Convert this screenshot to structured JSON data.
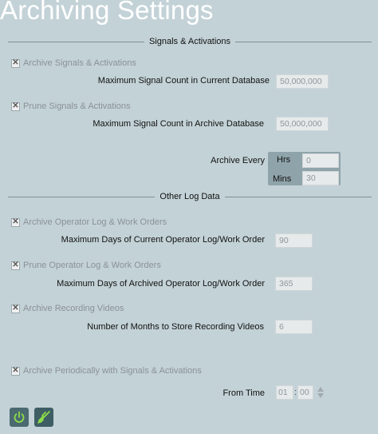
{
  "title": "Archiving Settings",
  "sections": {
    "signals": "Signals & Activations",
    "other": "Other Log Data"
  },
  "archive_signals": {
    "checkbox_label": "Archive Signals & Activations",
    "checked": true,
    "max_count_label": "Maximum Signal Count in Current Database",
    "max_count_value": "50,000,000"
  },
  "prune_signals": {
    "checkbox_label": "Prune Signals & Activations",
    "checked": true,
    "max_count_label": "Maximum Signal Count in Archive Database",
    "max_count_value": "50,000,000"
  },
  "archive_every": {
    "label": "Archive Every",
    "hrs_label": "Hrs",
    "hrs_value": "0",
    "mins_label": "Mins",
    "mins_value": "30"
  },
  "archive_operator_log": {
    "checkbox_label": "Archive Operator Log & Work Orders",
    "checked": true,
    "days_label": "Maximum Days of Current Operator Log/Work Order",
    "days_value": "90"
  },
  "prune_operator_log": {
    "checkbox_label": "Prune Operator Log & Work Orders",
    "checked": true,
    "days_label": "Maximum Days of Archived Operator Log/Work Order",
    "days_value": "365"
  },
  "archive_recordings": {
    "checkbox_label": "Archive Recording Videos",
    "checked": true,
    "months_label": "Number of Months to Store Recording Videos",
    "months_value": "6"
  },
  "archive_periodically": {
    "checkbox_label": "Archive Periodically with Signals & Activations",
    "checked": true,
    "from_time_label": "From Time",
    "hour_value": "01",
    "minute_value": "00",
    "colon": ":"
  },
  "check_mark": "✕",
  "icons": {
    "power": "power-icon",
    "disconnect": "plug-disconnect-icon"
  },
  "colors": {
    "background": "#c3d2d7",
    "button_bg": "#4a6a70",
    "icon_green": "#8ddc4a"
  }
}
